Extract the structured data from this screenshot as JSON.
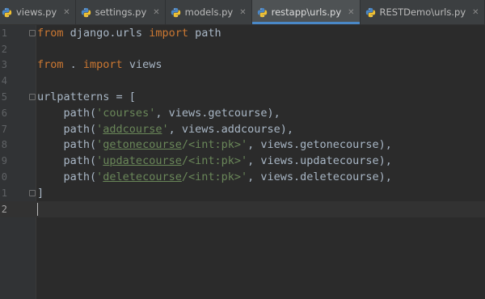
{
  "tabs": [
    {
      "label": "views.py",
      "active": false
    },
    {
      "label": "settings.py",
      "active": false
    },
    {
      "label": "models.py",
      "active": false
    },
    {
      "label": "restapp\\urls.py",
      "active": true
    },
    {
      "label": "RESTDemo\\urls.py",
      "active": false
    }
  ],
  "close_glyph": "✕",
  "colors": {
    "keyword": "#cc7832",
    "string": "#6a8759",
    "text": "#a9b7c6",
    "active_tab_underline": "#4a88c7"
  },
  "editor": {
    "line_numbers": [
      "1",
      "2",
      "3",
      "4",
      "5",
      "6",
      "7",
      "8",
      "9",
      "0",
      "1",
      "2"
    ],
    "current_line": 12,
    "lines": {
      "l1": {
        "kw1": "from",
        "t1": " django.urls ",
        "kw2": "import",
        "t2": " path"
      },
      "l3": {
        "kw1": "from",
        "t1": " . ",
        "kw2": "import",
        "t2": " views"
      },
      "l5": {
        "t": "urlpatterns = ["
      },
      "l6": {
        "pre": "    path(",
        "q1": "'",
        "s": "courses",
        "q2": "'",
        "post": ", views.getcourse),"
      },
      "l7": {
        "pre": "    path(",
        "q1": "'",
        "s": "addcourse",
        "q2": "'",
        "post": ", views.addcourse),"
      },
      "l8": {
        "pre": "    path(",
        "q1": "'",
        "s": "getonecourse",
        "rest": "/<int:pk>'",
        "post": ", views.getonecourse),"
      },
      "l9": {
        "pre": "    path(",
        "q1": "'",
        "s": "updatecourse",
        "rest": "/<int:pk>'",
        "post": ", views.updatecourse),"
      },
      "l10": {
        "pre": "    path(",
        "q1": "'",
        "s": "deletecourse",
        "rest": "/<int:pk>'",
        "post": ", views.deletecourse),"
      },
      "l11": {
        "t": "]"
      }
    }
  }
}
